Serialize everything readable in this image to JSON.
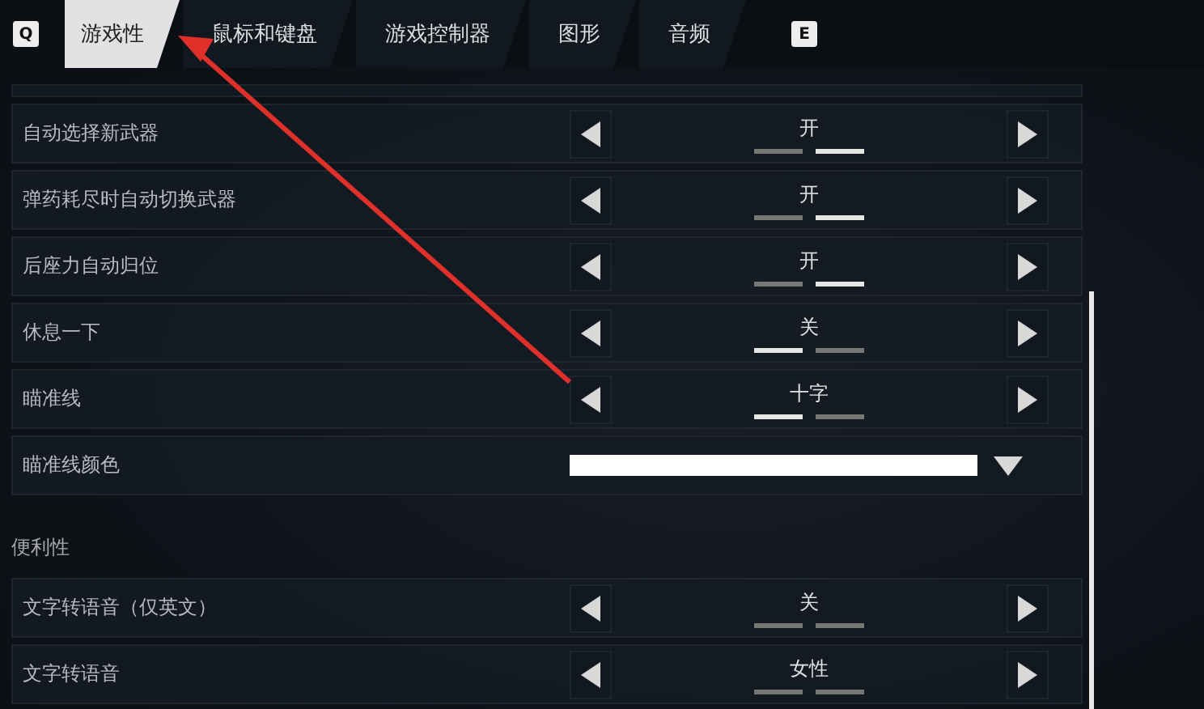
{
  "tabs": {
    "prev_key": "Q",
    "next_key": "E",
    "items": [
      {
        "label": "游戏性",
        "selected": true
      },
      {
        "label": "鼠标和键盘",
        "selected": false
      },
      {
        "label": "游戏控制器",
        "selected": false
      },
      {
        "label": "图形",
        "selected": false
      },
      {
        "label": "音频",
        "selected": false
      }
    ]
  },
  "sections": [
    {
      "rows": [
        {
          "kind": "stub"
        },
        {
          "kind": "option",
          "label": "自动选择新武器",
          "value": "开",
          "segments": [
            {
              "selected": false
            },
            {
              "selected": true
            }
          ]
        },
        {
          "kind": "option",
          "label": "弹药耗尽时自动切换武器",
          "value": "开",
          "segments": [
            {
              "selected": false
            },
            {
              "selected": true
            }
          ]
        },
        {
          "kind": "option",
          "label": "后座力自动归位",
          "value": "开",
          "segments": [
            {
              "selected": false
            },
            {
              "selected": true
            }
          ]
        },
        {
          "kind": "option",
          "label": "休息一下",
          "value": "关",
          "segments": [
            {
              "selected": true
            },
            {
              "selected": false
            }
          ]
        },
        {
          "kind": "option",
          "label": "瞄准线",
          "value": "十字",
          "segments": [
            {
              "selected": true
            },
            {
              "selected": false
            }
          ]
        },
        {
          "kind": "color",
          "label": "瞄准线颜色",
          "color": "#ffffff"
        }
      ]
    },
    {
      "title": "便利性",
      "rows": [
        {
          "kind": "option",
          "label": "文字转语音（仅英文）",
          "value": "关",
          "segments": [
            {
              "selected": false
            },
            {
              "selected": false
            }
          ]
        },
        {
          "kind": "option",
          "label": "文字转语音",
          "value": "女性",
          "segments": [
            {
              "selected": false
            },
            {
              "selected": false
            }
          ]
        }
      ]
    }
  ]
}
